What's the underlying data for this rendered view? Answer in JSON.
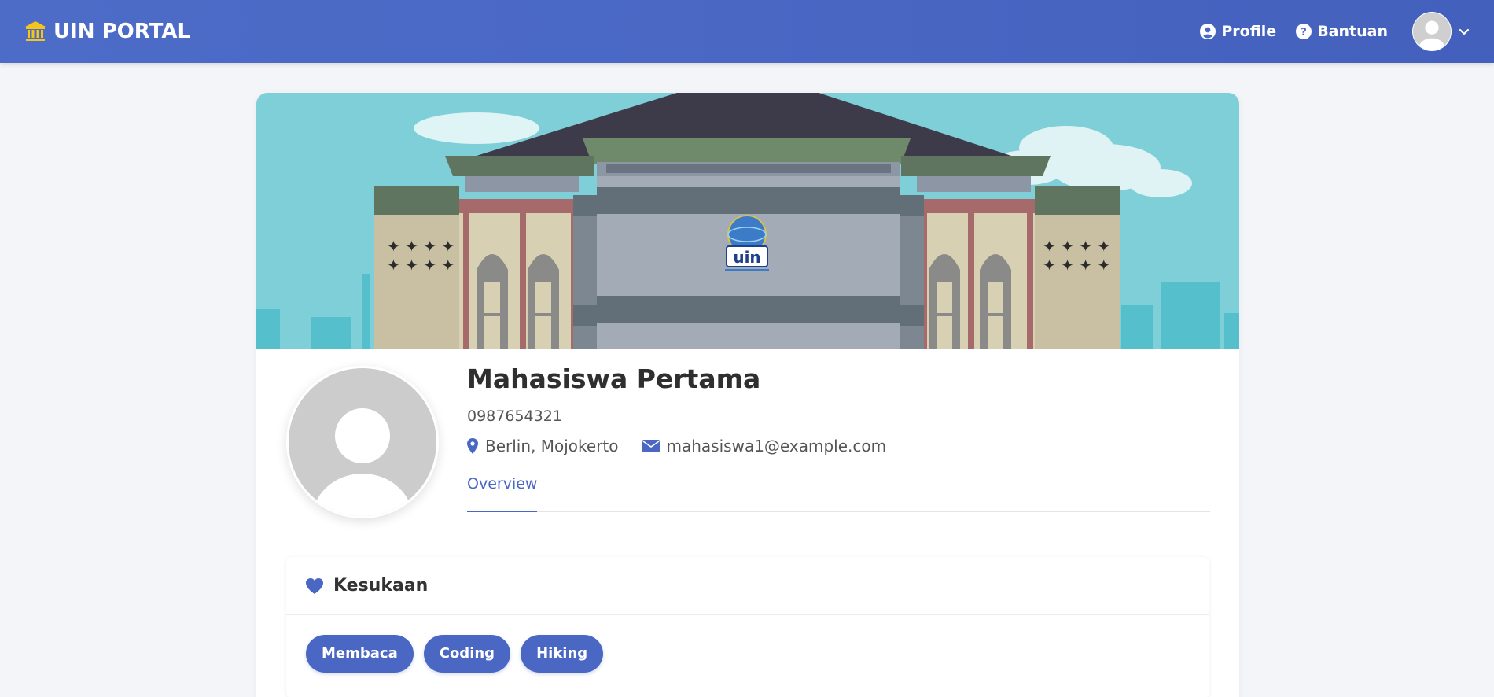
{
  "navbar": {
    "brand": "UIN PORTAL",
    "brand_icon": "building-columns-icon",
    "links": [
      {
        "label": "Profile",
        "icon": "user-circle-icon"
      },
      {
        "label": "Bantuan",
        "icon": "question-circle-icon"
      }
    ],
    "avatar_icon": "user-avatar-icon",
    "caret_icon": "chevron-down-icon"
  },
  "colors": {
    "primary": "#4a67c4",
    "brand_icon": "#f5c518",
    "background": "#f4f5f9"
  },
  "banner": {
    "logo_text": "uin"
  },
  "profile": {
    "name": "Mahasiswa Pertama",
    "nim": "0987654321",
    "location": "Berlin, Mojokerto",
    "email": "mahasiswa1@example.com",
    "tabs": [
      {
        "label": "Overview",
        "active": true
      }
    ]
  },
  "hobbies": {
    "title": "Kesukaan",
    "icon": "heart-icon",
    "items": [
      "Membaca",
      "Coding",
      "Hiking"
    ]
  }
}
